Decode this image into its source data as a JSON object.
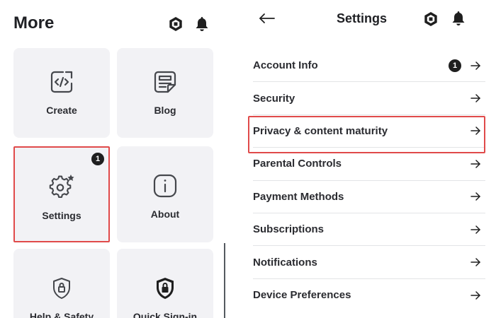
{
  "more_panel": {
    "title": "More",
    "header_icons": [
      "robux-icon",
      "bell-icon"
    ],
    "tiles": [
      {
        "label": "Create",
        "icon": "code-icon"
      },
      {
        "label": "Blog",
        "icon": "blog-icon"
      },
      {
        "label": "Settings",
        "icon": "gear-icon",
        "badge": "1",
        "highlighted": true
      },
      {
        "label": "About",
        "icon": "info-icon"
      },
      {
        "label": "Help & Safety",
        "icon": "shield-lock-icon"
      },
      {
        "label": "Quick Sign-in",
        "icon": "shield-lock-filled-icon"
      }
    ]
  },
  "settings_panel": {
    "title": "Settings",
    "back_icon": "back-arrow-icon",
    "header_icons": [
      "robux-icon",
      "bell-icon"
    ],
    "items": [
      {
        "label": "Account Info",
        "badge": "1"
      },
      {
        "label": "Security"
      },
      {
        "label": "Privacy & content maturity",
        "highlighted": true
      },
      {
        "label": "Parental Controls"
      },
      {
        "label": "Payment Methods"
      },
      {
        "label": "Subscriptions"
      },
      {
        "label": "Notifications"
      },
      {
        "label": "Device Preferences"
      }
    ]
  },
  "colors": {
    "tile_background": "#f2f2f5",
    "highlight": "#e04a4a",
    "text": "#1f2024",
    "badge": "#1f1f1f",
    "divider": "#e3e4e6"
  }
}
